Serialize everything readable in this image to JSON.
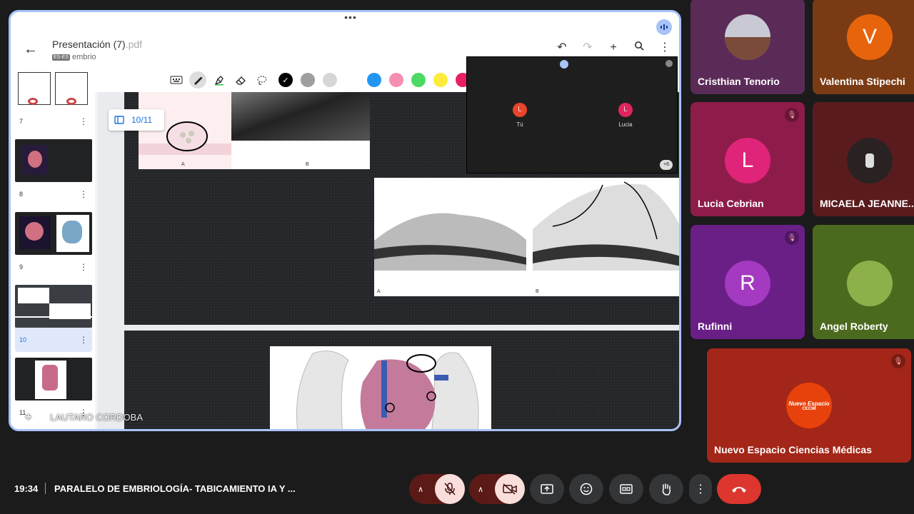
{
  "document": {
    "title": "Presentación (7)",
    "ext": ".pdf",
    "lang_tag": "ES-ES",
    "subtitle": "embrio"
  },
  "toolbar": {
    "colors": [
      "#000000",
      "#9e9e9e",
      "#d6d6d6",
      "#ffffff",
      "#2196f3",
      "#f48fb1",
      "#4cd964",
      "#ffeb3b",
      "#e91e63"
    ]
  },
  "thumbnails": [
    {
      "page": "7"
    },
    {
      "page": "8"
    },
    {
      "page": "9"
    },
    {
      "page": "10"
    },
    {
      "page": "11"
    }
  ],
  "page_indicator": "10/11",
  "slide_labels": {
    "a1": "A",
    "b1": "B",
    "a2": "A",
    "b2": "B"
  },
  "pip": {
    "tiles": [
      {
        "name": "Tú",
        "initial": "L",
        "color": "#e8452c"
      },
      {
        "name": "Lucia",
        "initial": "L",
        "color": "#e0245e"
      }
    ],
    "more": "+6"
  },
  "presenter_name": "LAUTARO CORDOBA",
  "participants": [
    {
      "name": "Cristhian Tenorio",
      "initial": "",
      "bg": "#5b2b58",
      "avatar_color": "#c9c9d4",
      "muted": false,
      "has_photo": true
    },
    {
      "name": "Valentina Stipechi",
      "initial": "V",
      "bg": "#7a3b14",
      "avatar_color": "#e8640c",
      "muted": false,
      "has_photo": false
    },
    {
      "name": "Lucia Cebrian",
      "initial": "L",
      "bg": "#8e1c4a",
      "avatar_color": "#e0247a",
      "muted": true,
      "has_photo": false
    },
    {
      "name": "MICAELA JEANNE...",
      "initial": "",
      "bg": "#5a1b1e",
      "avatar_color": "#2a2222",
      "muted": true,
      "has_photo": true
    },
    {
      "name": "Rufinni",
      "initial": "R",
      "bg": "#6a1f86",
      "avatar_color": "#a33ac0",
      "muted": true,
      "has_photo": false
    },
    {
      "name": "Angel Roberty",
      "initial": "",
      "bg": "#4c6a1e",
      "avatar_color": "#8eb04a",
      "muted": true,
      "has_photo": true
    },
    {
      "name": "Nuevo Espacio Ciencias Médicas",
      "initial": "",
      "bg": "#a32618",
      "avatar_color": "#e8420c",
      "muted": true,
      "has_photo": true,
      "logo_text": "Nuevo Espacio",
      "logo_sub": "CECIM"
    }
  ],
  "bottom": {
    "time": "19:34",
    "meeting_title": "PARALELO DE EMBRIOLOGÍA- TABICAMIENTO IA Y ..."
  }
}
